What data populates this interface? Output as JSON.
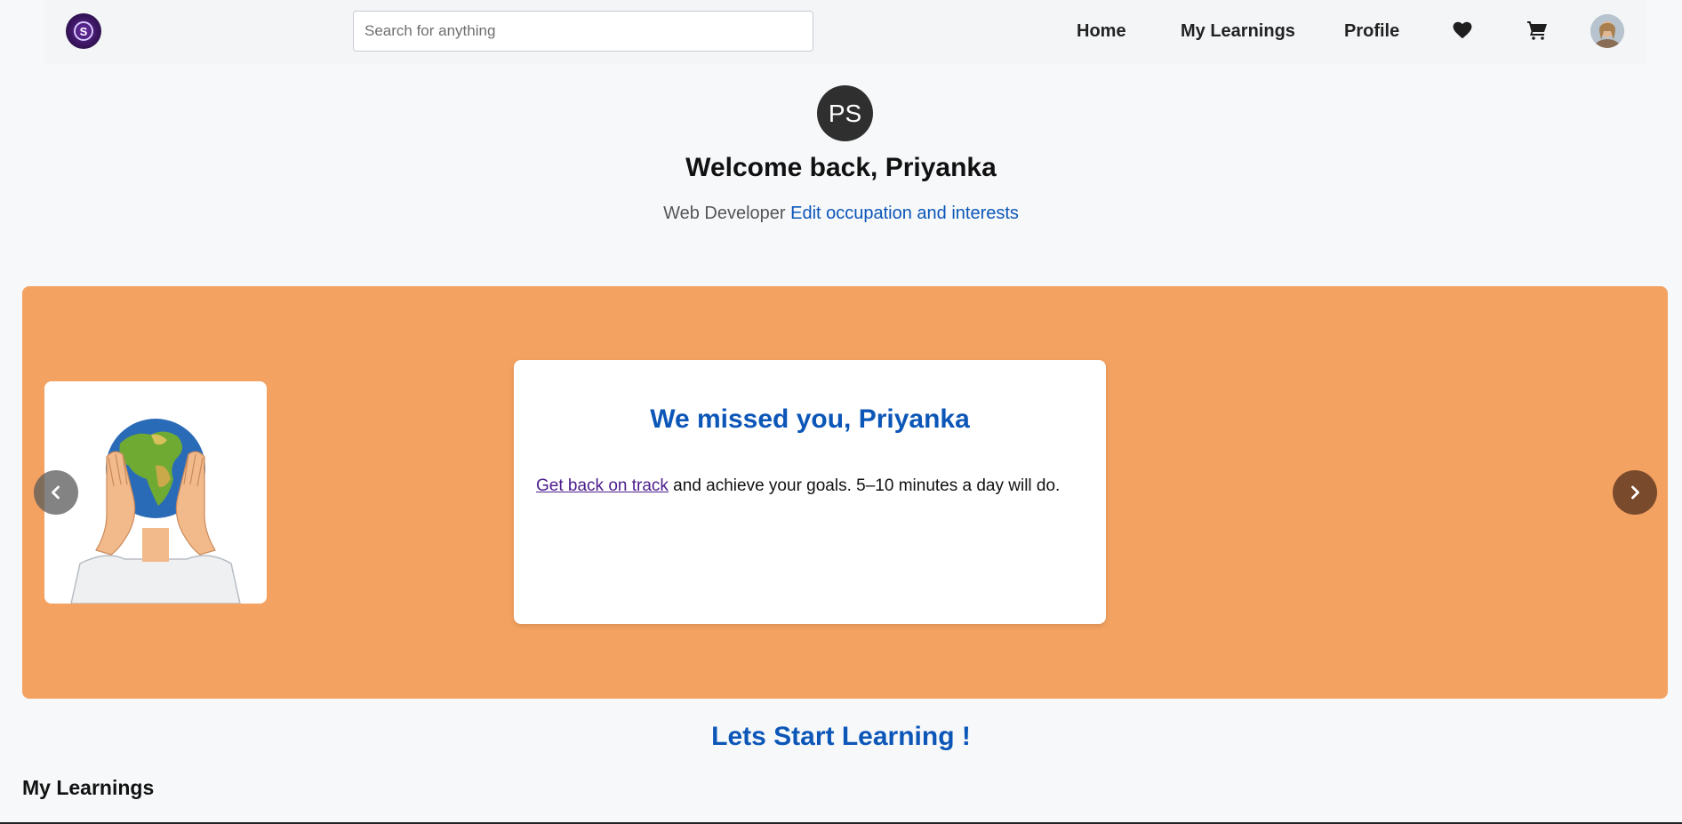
{
  "header": {
    "search_placeholder": "Search for anything",
    "nav": {
      "home": "Home",
      "my_learnings": "My Learnings",
      "profile": "Profile"
    },
    "icons": {
      "logo": "logo-icon",
      "wishlist": "heart-icon",
      "cart": "cart-icon",
      "user": "avatar"
    }
  },
  "welcome": {
    "initials": "PS",
    "heading": "Welcome back, Priyanka",
    "occupation": "Web Developer",
    "edit_link": "Edit occupation and interests"
  },
  "carousel": {
    "card_title": "We missed you, Priyanka",
    "link_text": "Get back on track",
    "body_text": " and achieve your goals. 5–10 minutes a day will do.",
    "background_color": "#f3a261",
    "prev_icon": "chevron-left-icon",
    "next_icon": "chevron-right-icon"
  },
  "main": {
    "cta": "Lets Start Learning !",
    "section_title": "My Learnings"
  },
  "colors": {
    "accent": "#0c56b8",
    "page_bg": "#f6f8fa"
  }
}
